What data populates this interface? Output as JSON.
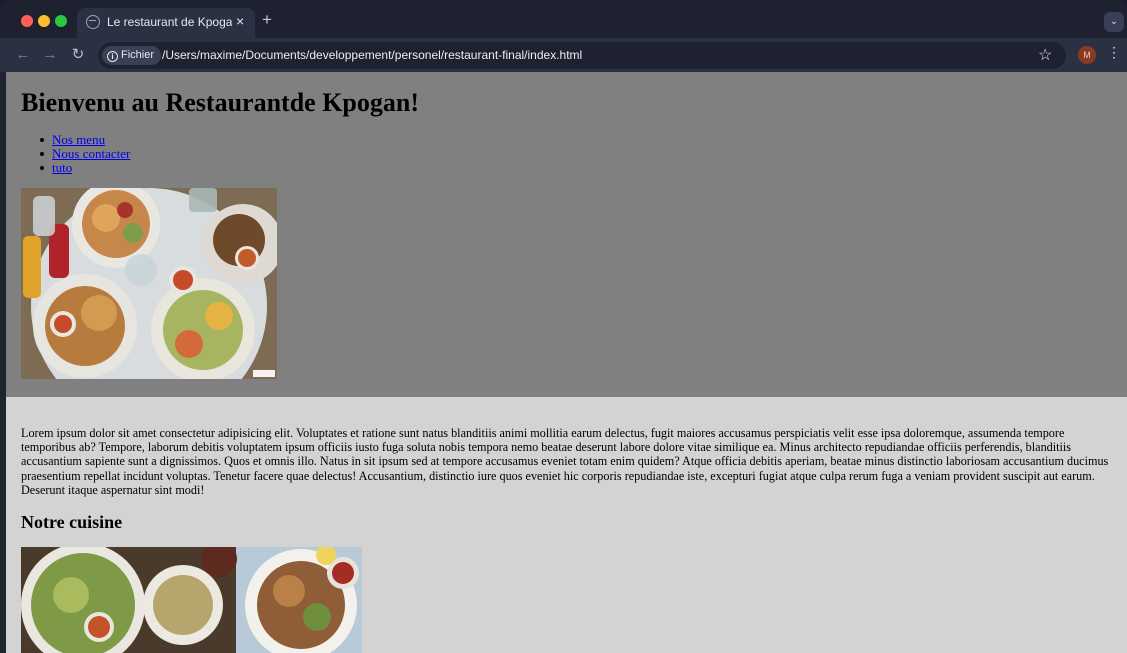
{
  "browser": {
    "tab_title": "Le restaurant de Kpogan, un",
    "tab_close": "×",
    "new_tab": "+",
    "tab_menu": "⌄",
    "back": "←",
    "forward": "→",
    "reload": "↻",
    "chip_label": "Fichier",
    "url": "/Users/maxime/Documents/developpement/personel/restaurant-final/index.html",
    "star": "☆",
    "avatar": "M",
    "menu": "⋮"
  },
  "page": {
    "title": "Bienvenu au Restaurantde Kpogan!",
    "nav": [
      {
        "label": "Nos menu"
      },
      {
        "label": "Nous contacter"
      },
      {
        "label": "tuto"
      }
    ],
    "intro": "Lorem ipsum dolor sit amet consectetur adipisicing elit. Voluptates et ratione sunt natus blanditiis animi mollitia earum delectus, fugit maiores accusamus perspiciatis velit esse ipsa doloremque, assumenda tempore temporibus ab? Tempore, laborum debitis voluptatem ipsum officiis iusto fuga soluta nobis tempora nemo beatae deserunt labore dolore vitae similique ea. Minus architecto repudiandae officiis perferendis, blanditiis accusantium sapiente sunt a dignissimos. Quos et omnis illo. Natus in sit ipsum sed at tempore accusamus eveniet totam enim quidem? Atque officia debitis aperiam, beatae minus distinctio laboriosam accusantium ducimus praesentium repellat incidunt voluptas. Tenetur facere quae delectus! Accusantium, distinctio iure quos eveniet hic corporis repudiandae iste, excepturi fugiat atque culpa rerum fuga a veniam provident suscipit aut earum. Deserunt itaque aspernatur sint modi!",
    "section_heading": "Notre cuisine"
  },
  "colors": {
    "header_bg": "#808080",
    "page_bg": "#d3d3d3",
    "link": "#0000ee"
  }
}
